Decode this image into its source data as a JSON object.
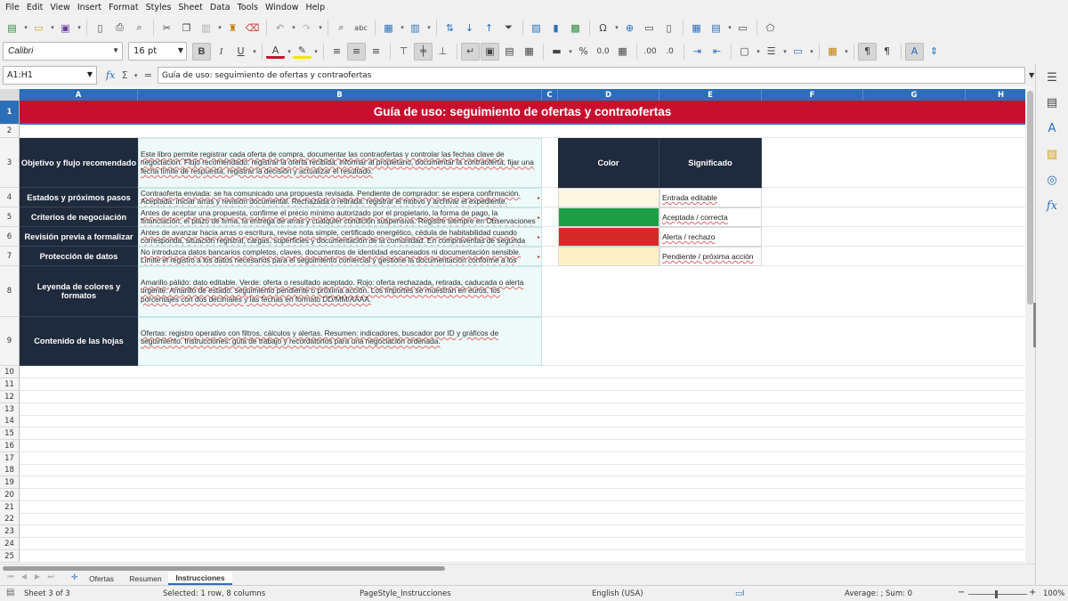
{
  "menu": [
    "File",
    "Edit",
    "View",
    "Insert",
    "Format",
    "Styles",
    "Sheet",
    "Data",
    "Tools",
    "Window",
    "Help"
  ],
  "format_toolbar": {
    "font_name": "Calibri",
    "font_size": "16 pt"
  },
  "formula_bar": {
    "name_box": "A1:H1",
    "content": "Guía de uso: seguimiento de ofertas y contraofertas"
  },
  "columns": [
    "A",
    "B",
    "C",
    "D",
    "E",
    "F",
    "G",
    "H"
  ],
  "rows": [
    "1",
    "2",
    "3",
    "4",
    "5",
    "6",
    "7",
    "8",
    "9",
    "10",
    "11",
    "12",
    "13",
    "14",
    "15",
    "16",
    "17",
    "18",
    "19",
    "20",
    "21",
    "22",
    "23",
    "24",
    "25"
  ],
  "sheet": {
    "title": "Guía de uso: seguimiento de ofertas y contraofertas",
    "sections": [
      {
        "label": "Objetivo y flujo recomendado",
        "text": "Este libro permite registrar cada oferta de compra, documentar las contraofertas y controlar las fechas clave de negociación. Flujo recomendado: registrar la oferta recibida, informar al propietario, documentar la contraoferta, fijar una fecha límite de respuesta, registrar la decisión y actualizar el resultado."
      },
      {
        "label": "Estados y próximos pasos",
        "text": "Contraoferta enviada: se ha comunicado una propuesta revisada. Pendiente de comprador: se espera confirmación. Aceptada: iniciar arras y revisión documental. Rechazada o retirada: registrar el motivo y archivar el expediente. Caducada: confirmar si"
      },
      {
        "label": "Criterios de negociación",
        "text": "Antes de aceptar una propuesta, confirme el precio mínimo autorizado por el propietario, la forma de pago, la financiación, el plazo de firma, la entrega de arras y cualquier condición suspensiva. Registre siempre en Observaciones las instrucciones expresas del propietario."
      },
      {
        "label": "Revisión previa a formalizar",
        "text": "Antes de avanzar hacia arras o escritura, revise nota simple, certificado energético, cédula de habitabilidad cuando corresponda, situación registral, cargas, superficies y documentación de la comunidad. En compraventas de segunda mano considere ITP y plusvalía municipal; en obra nueva, IVA y AJD."
      },
      {
        "label": "Protección de datos",
        "text": "No introduzca datos bancarios completos, claves, documentos de identidad escaneados ni documentación sensible. Limite el registro a los datos necesarios para el seguimiento comercial y gestione la documentación conforme a los procedimientos internos."
      },
      {
        "label": "Leyenda de colores y formatos",
        "text": "Amarillo pálido: dato editable. Verde: oferta o resultado aceptado. Rojo: oferta rechazada, retirada, caducada o alerta urgente. Amarillo de estado: seguimiento pendiente o próxima acción. Los importes se muestran en euros, los porcentajes con dos decimales y las fechas en formato DD/MM/AAAA."
      },
      {
        "label": "Contenido de las hojas",
        "text": "Ofertas: registro operativo con filtros, cálculos y alertas. Resumen: indicadores, buscador por ID y gráficos de seguimiento. Instrucciones: guía de trabajo y recordatorios para una negociación ordenada."
      }
    ],
    "legend": {
      "header_color": "Color",
      "header_meaning": "Significado",
      "items": [
        {
          "color": "#fdf6e3",
          "label": "Entrada editable"
        },
        {
          "color": "#1e9e47",
          "label": "Aceptada / correcta"
        },
        {
          "color": "#d62a2a",
          "label": "Alerta / rechazo"
        },
        {
          "color": "#fdf0c6",
          "label": "Pendiente / próxima acción"
        }
      ]
    }
  },
  "tabs": [
    "Ofertas",
    "Resumen",
    "Instrucciones"
  ],
  "active_tab": "Instrucciones",
  "status": {
    "sheet": "Sheet 3 of 3",
    "selection": "Selected: 1 row, 8 columns",
    "page_style": "PageStyle_Instrucciones",
    "language": "English (USA)",
    "summary": "Average: ; Sum: 0",
    "zoom": "100%"
  },
  "colors": {
    "title_bg": "#c8102e",
    "navy": "#1f2a3c",
    "accent": "#2a6fb8",
    "desc_bg": "#eefaf9"
  },
  "icons": [
    "new-icon",
    "open-icon",
    "save-icon",
    "export-pdf-icon",
    "print-icon",
    "print-preview-icon",
    "cut-icon",
    "copy-icon",
    "paste-icon",
    "clone-icon",
    "clear-icon",
    "undo-icon",
    "redo-icon",
    "find-icon",
    "spelling-icon",
    "row-icon",
    "column-icon",
    "sort-icon",
    "sort-asc-icon",
    "sort-desc-icon",
    "autofilter-icon",
    "image-icon",
    "chart-icon",
    "pivot-icon",
    "special-char-icon",
    "hyperlink-icon",
    "comment-icon",
    "header-footer-icon",
    "define-print-area-icon",
    "freeze-icon",
    "split-icon",
    "show-draw-icon",
    "bold-icon",
    "italic-icon",
    "underline-icon",
    "font-color-icon",
    "highlight-icon",
    "align-left-icon",
    "align-center-icon",
    "align-right-icon",
    "align-top-icon",
    "align-middle-icon",
    "align-bottom-icon",
    "wrap-icon",
    "merge-center-icon",
    "merge-icon",
    "unmerge-icon",
    "currency-icon",
    "percent-icon",
    "decimal-icon",
    "date-icon",
    "add-decimal-icon",
    "remove-decimal-icon",
    "indent-icon",
    "outdent-icon",
    "borders-icon",
    "border-style-icon",
    "border-color-icon",
    "conditional-icon",
    "ltr-icon",
    "rtl-icon",
    "wrap-text-icon",
    "vertical-text-icon"
  ]
}
